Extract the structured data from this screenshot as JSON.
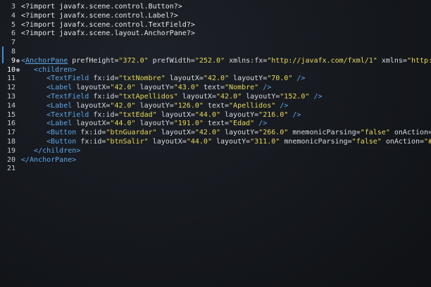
{
  "editor": {
    "lines": [
      {
        "num": "3",
        "tokens": [
          {
            "c": "t-text",
            "t": "<?import javafx.scene.control.Button?>"
          }
        ]
      },
      {
        "num": "4",
        "tokens": [
          {
            "c": "t-text",
            "t": "<?import javafx.scene.control.Label?>"
          }
        ]
      },
      {
        "num": "5",
        "tokens": [
          {
            "c": "t-text",
            "t": "<?import javafx.scene.control.TextField?>"
          }
        ]
      },
      {
        "num": "6",
        "tokens": [
          {
            "c": "t-text",
            "t": "<?import javafx.scene.layout.AnchorPane?>"
          }
        ]
      },
      {
        "num": "7",
        "tokens": []
      },
      {
        "num": "8",
        "tokens": []
      },
      {
        "num": "9",
        "marker": true,
        "highlight": true,
        "tokens": [
          {
            "c": "t-tag",
            "t": "<"
          },
          {
            "c": "t-tag u",
            "t": "AnchorPane"
          },
          {
            "c": "t-attr",
            "t": " prefHeight="
          },
          {
            "c": "t-str",
            "t": "\"372.0\""
          },
          {
            "c": "t-attr",
            "t": " prefWidth="
          },
          {
            "c": "t-str",
            "t": "\"252.0\""
          },
          {
            "c": "t-attr",
            "t": " xmlns:fx="
          },
          {
            "c": "t-str",
            "t": "\"http://javafx.com/fxml/1\""
          },
          {
            "c": "t-attr",
            "t": " xmlns="
          },
          {
            "c": "t-str",
            "t": "\"http://"
          }
        ]
      },
      {
        "num": "10",
        "marker": true,
        "highlight": true,
        "tokens": [
          {
            "c": "t-tag",
            "t": "   <children>"
          }
        ]
      },
      {
        "num": "11",
        "tokens": [
          {
            "c": "t-tag",
            "t": "      <TextField"
          },
          {
            "c": "t-attr",
            "t": " fx:id="
          },
          {
            "c": "t-str",
            "t": "\"txtNombre\""
          },
          {
            "c": "t-attr",
            "t": " layoutX="
          },
          {
            "c": "t-str",
            "t": "\"42.0\""
          },
          {
            "c": "t-attr",
            "t": " layoutY="
          },
          {
            "c": "t-str",
            "t": "\"70.0\""
          },
          {
            "c": "t-tag",
            "t": " />"
          }
        ]
      },
      {
        "num": "12",
        "tokens": [
          {
            "c": "t-tag",
            "t": "      <Label"
          },
          {
            "c": "t-attr",
            "t": " layoutX="
          },
          {
            "c": "t-str",
            "t": "\"42.0\""
          },
          {
            "c": "t-attr",
            "t": " layoutY="
          },
          {
            "c": "t-str",
            "t": "\"43.0\""
          },
          {
            "c": "t-attr",
            "t": " text="
          },
          {
            "c": "t-str",
            "t": "\"Nombre\""
          },
          {
            "c": "t-tag",
            "t": " />"
          }
        ]
      },
      {
        "num": "13",
        "tokens": [
          {
            "c": "t-tag",
            "t": "      <TextField"
          },
          {
            "c": "t-attr",
            "t": " fx:id="
          },
          {
            "c": "t-str",
            "t": "\"txtApellidos\""
          },
          {
            "c": "t-attr",
            "t": " layoutX="
          },
          {
            "c": "t-str",
            "t": "\"42.0\""
          },
          {
            "c": "t-attr",
            "t": " layoutY="
          },
          {
            "c": "t-str",
            "t": "\"152.0\""
          },
          {
            "c": "t-tag",
            "t": " />"
          }
        ]
      },
      {
        "num": "14",
        "tokens": [
          {
            "c": "t-tag",
            "t": "      <Label"
          },
          {
            "c": "t-attr",
            "t": " layoutX="
          },
          {
            "c": "t-str",
            "t": "\"42.0\""
          },
          {
            "c": "t-attr",
            "t": " layoutY="
          },
          {
            "c": "t-str",
            "t": "\"126.0\""
          },
          {
            "c": "t-attr",
            "t": " text="
          },
          {
            "c": "t-str",
            "t": "\"Apellidos\""
          },
          {
            "c": "t-tag",
            "t": " />"
          }
        ]
      },
      {
        "num": "15",
        "tokens": [
          {
            "c": "t-tag",
            "t": "      <TextField"
          },
          {
            "c": "t-attr",
            "t": " fx:id="
          },
          {
            "c": "t-str",
            "t": "\"txtEdad\""
          },
          {
            "c": "t-attr",
            "t": " layoutX="
          },
          {
            "c": "t-str",
            "t": "\"44.0\""
          },
          {
            "c": "t-attr",
            "t": " layoutY="
          },
          {
            "c": "t-str",
            "t": "\"216.0\""
          },
          {
            "c": "t-tag",
            "t": " />"
          }
        ]
      },
      {
        "num": "16",
        "tokens": [
          {
            "c": "t-tag",
            "t": "      <Label"
          },
          {
            "c": "t-attr",
            "t": " layoutX="
          },
          {
            "c": "t-str",
            "t": "\"44.0\""
          },
          {
            "c": "t-attr",
            "t": " layoutY="
          },
          {
            "c": "t-str",
            "t": "\"191.0\""
          },
          {
            "c": "t-attr",
            "t": " text="
          },
          {
            "c": "t-str",
            "t": "\"Edad\""
          },
          {
            "c": "t-tag",
            "t": " />"
          }
        ]
      },
      {
        "num": "17",
        "tokens": [
          {
            "c": "t-tag",
            "t": "      <Button"
          },
          {
            "c": "t-attr",
            "t": " fx:id="
          },
          {
            "c": "t-str",
            "t": "\"btnGuardar\""
          },
          {
            "c": "t-attr",
            "t": " layoutX="
          },
          {
            "c": "t-str",
            "t": "\"42.0\""
          },
          {
            "c": "t-attr",
            "t": " layoutY="
          },
          {
            "c": "t-str",
            "t": "\"266.0\""
          },
          {
            "c": "t-attr",
            "t": " mnemonicParsing="
          },
          {
            "c": "t-str",
            "t": "\"false\""
          },
          {
            "c": "t-attr",
            "t": " onAction="
          },
          {
            "c": "t-str",
            "t": "\"#"
          }
        ]
      },
      {
        "num": "18",
        "tokens": [
          {
            "c": "t-tag",
            "t": "      <Button"
          },
          {
            "c": "t-attr",
            "t": " fx:id="
          },
          {
            "c": "t-str",
            "t": "\"btnSalir\""
          },
          {
            "c": "t-attr",
            "t": " layoutX="
          },
          {
            "c": "t-str",
            "t": "\"44.0\""
          },
          {
            "c": "t-attr",
            "t": " layoutY="
          },
          {
            "c": "t-str",
            "t": "\"311.0\""
          },
          {
            "c": "t-attr",
            "t": " mnemonicParsing="
          },
          {
            "c": "t-str",
            "t": "\"false\""
          },
          {
            "c": "t-attr",
            "t": " onAction="
          },
          {
            "c": "t-str",
            "t": "\"#sa"
          }
        ]
      },
      {
        "num": "19",
        "tokens": [
          {
            "c": "t-tag",
            "t": "   </children>"
          }
        ]
      },
      {
        "num": "20",
        "tokens": [
          {
            "c": "t-tag",
            "t": "</AnchorPane>"
          }
        ]
      },
      {
        "num": "21",
        "tokens": []
      }
    ]
  }
}
